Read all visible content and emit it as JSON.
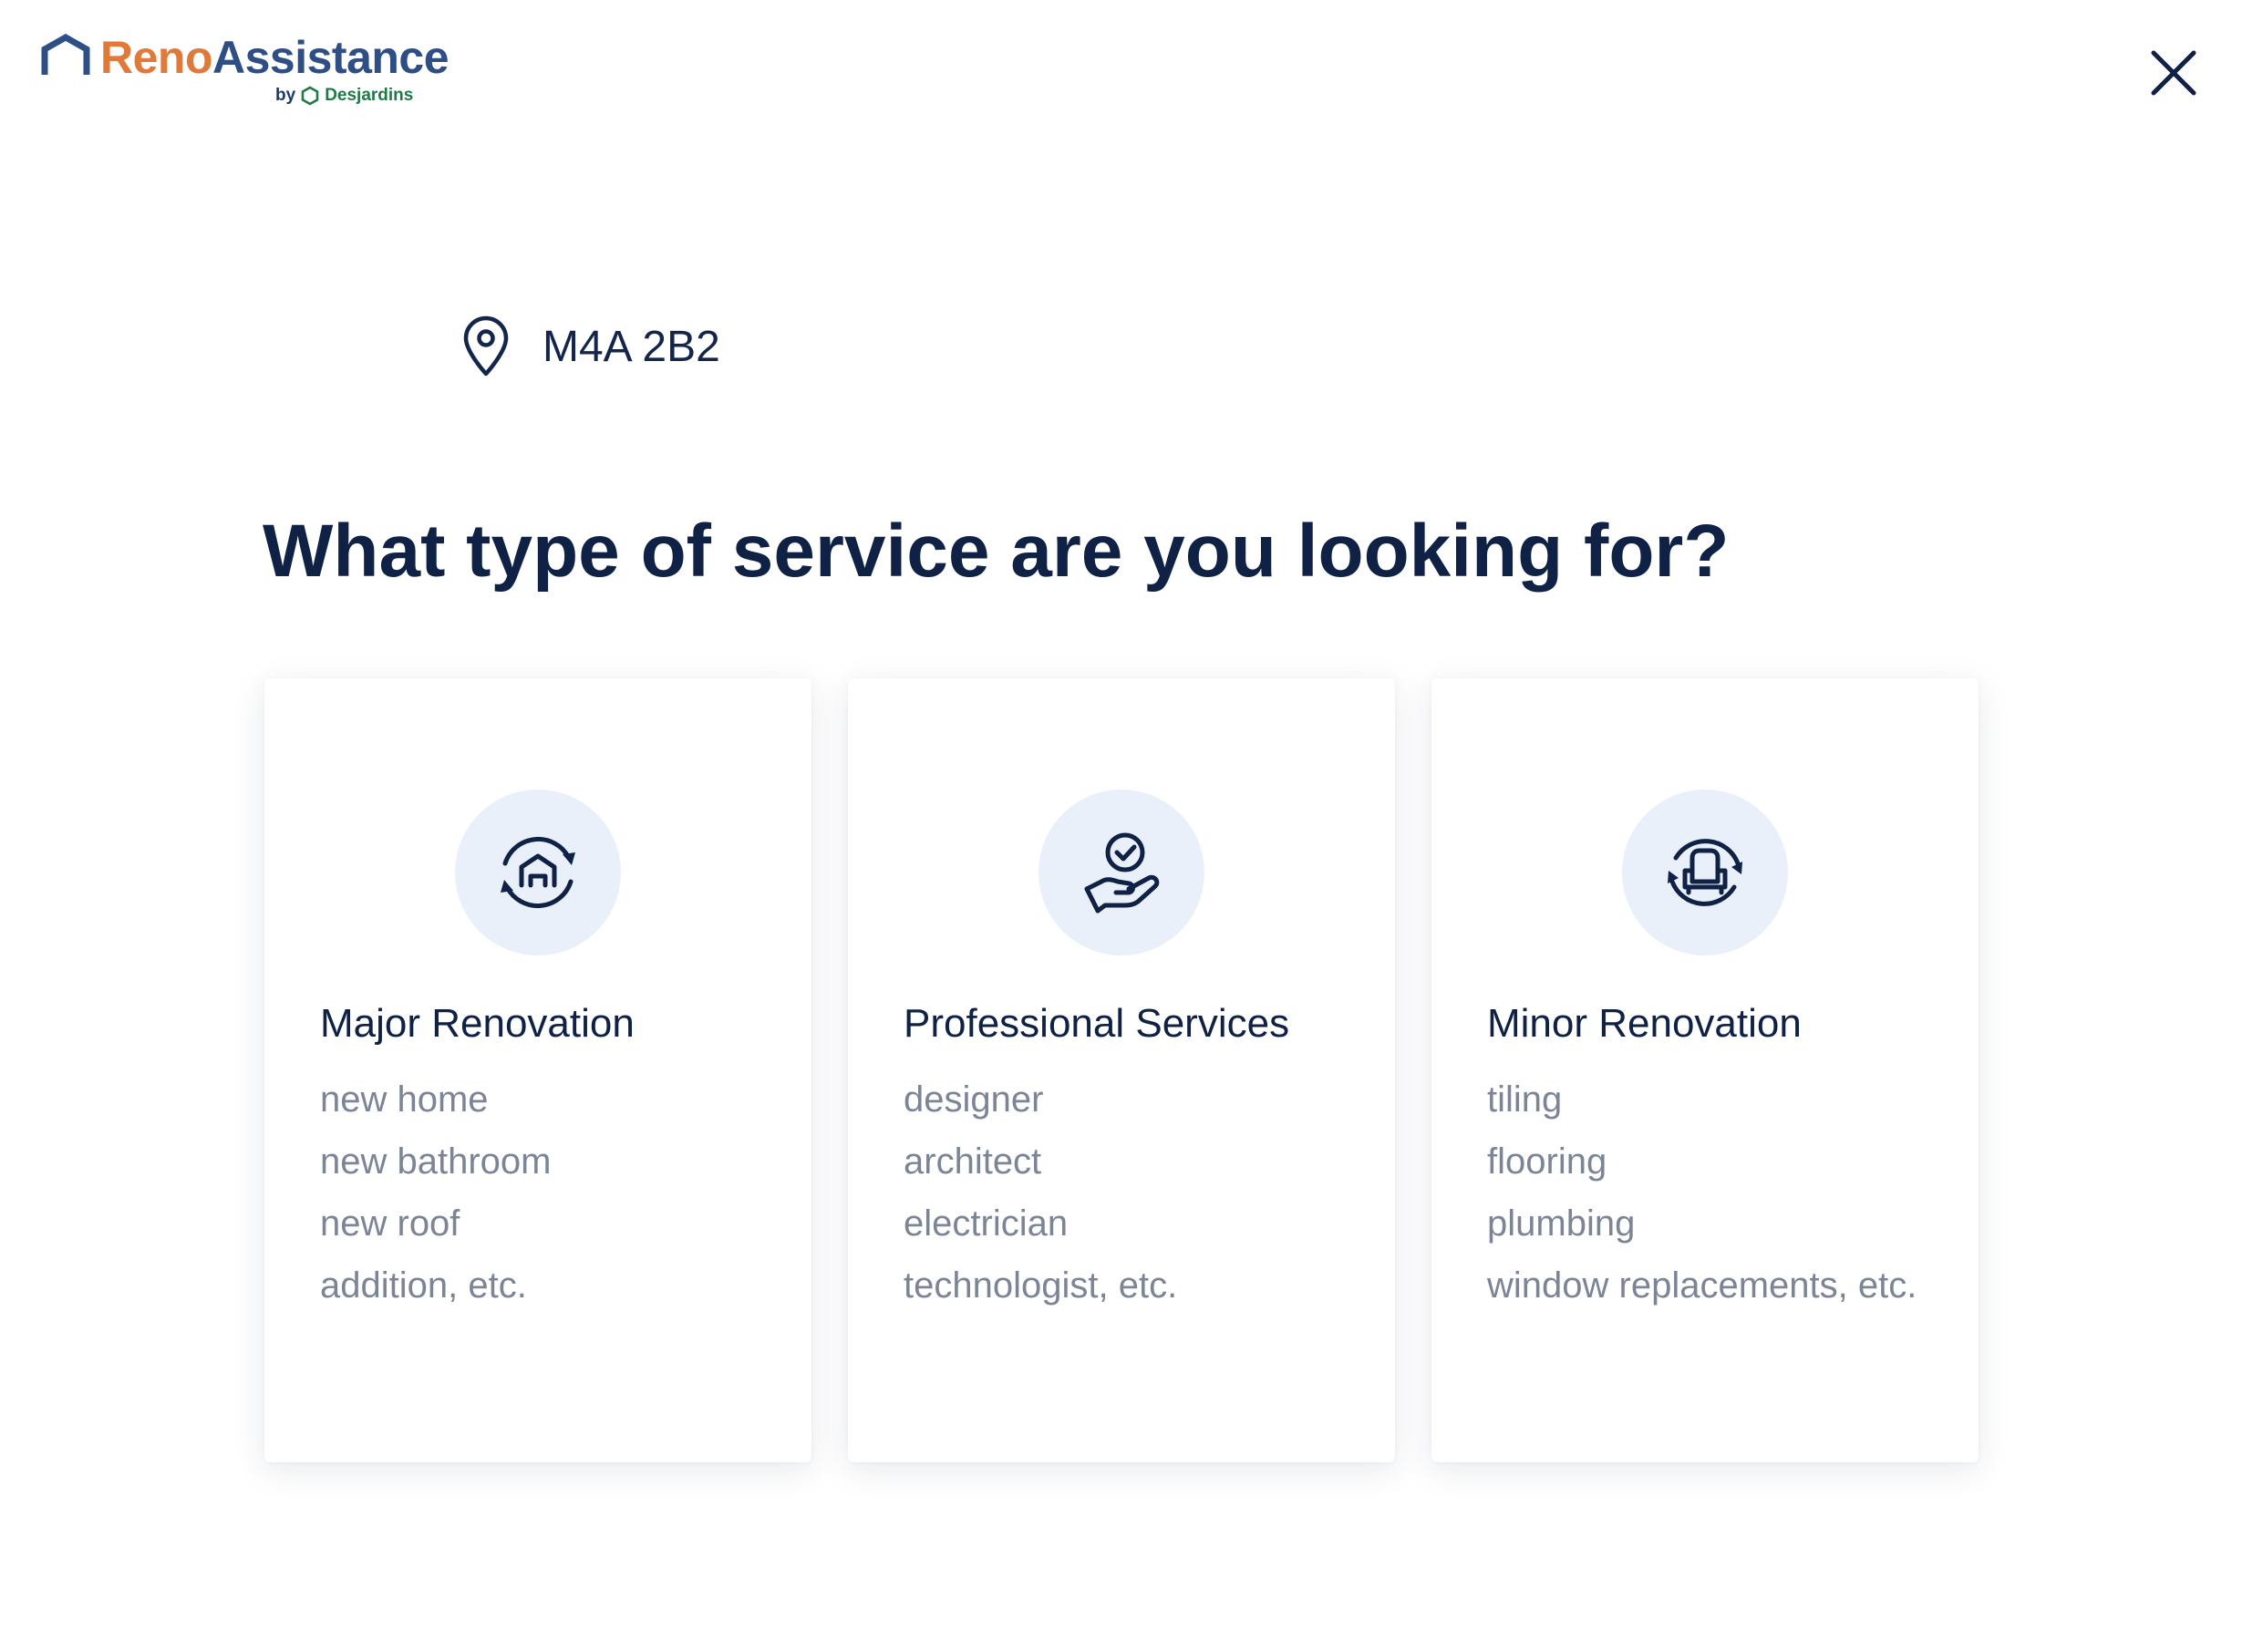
{
  "header": {
    "brand_part1": "Reno",
    "brand_part2": "Assistance",
    "by": "by",
    "partner": "Desjardins"
  },
  "location": {
    "postal_code": "M4A 2B2"
  },
  "main": {
    "title": "What type of service are you looking for?"
  },
  "cards": [
    {
      "title": "Major Renovation",
      "icon": "house-renovation-icon",
      "items": [
        "new home",
        "new bathroom",
        "new roof",
        "addition, etc."
      ]
    },
    {
      "title": "Professional Services",
      "icon": "hand-check-icon",
      "items": [
        "designer",
        "architect",
        "electrician",
        "technologist, etc."
      ]
    },
    {
      "title": "Minor Renovation",
      "icon": "armchair-refresh-icon",
      "items": [
        "tiling",
        "flooring",
        "plumbing",
        "window replacements, etc."
      ]
    }
  ],
  "colors": {
    "brand_orange": "#e07a3a",
    "brand_blue": "#2e4f86",
    "desjardins_green": "#1e7a47",
    "text_dark": "#0f2145",
    "text_muted": "#7b8596",
    "icon_circle_bg": "#e9f0fa"
  }
}
